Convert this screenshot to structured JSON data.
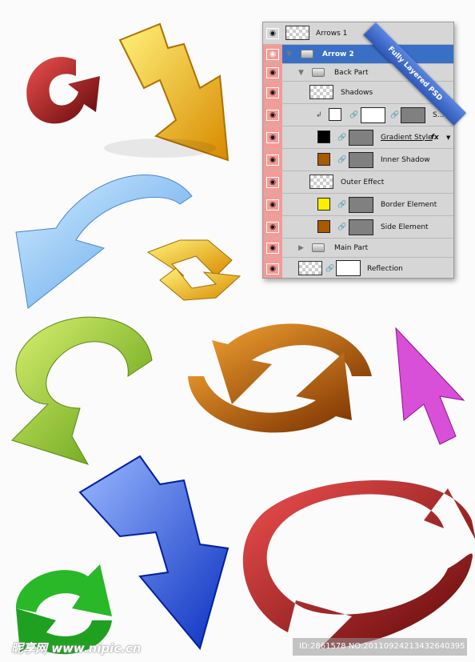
{
  "badge": "Fully Layered PSD",
  "layers": [
    {
      "name": "Arrows 1",
      "type": "smart",
      "visible": true
    },
    {
      "name": "Arrow 2",
      "type": "group",
      "expanded": true,
      "selected": true
    },
    {
      "name": "Back Part",
      "type": "group",
      "expanded": true
    },
    {
      "name": "Shadows",
      "type": "layer"
    },
    {
      "name": "S...",
      "type": "clipped",
      "swatch": "#ffffff"
    },
    {
      "name": "Gradient Style",
      "type": "shape",
      "swatch": "#000000",
      "fx": "fx"
    },
    {
      "name": "Inner Shadow",
      "type": "shape",
      "swatch": "#a85a00"
    },
    {
      "name": "Outer Effect",
      "type": "layer"
    },
    {
      "name": "Border Element",
      "type": "shape",
      "swatch": "#ffee00"
    },
    {
      "name": "Side Element",
      "type": "shape",
      "swatch": "#a85a00"
    },
    {
      "name": "Main Part",
      "type": "group",
      "expanded": false
    },
    {
      "name": "Reflection",
      "type": "masked"
    }
  ],
  "icons": {
    "visibility": "eye-icon",
    "link": "chain-link-icon",
    "folder": "folder-icon"
  },
  "arrow_colors": [
    "#b0202a",
    "#f0b800",
    "#7ab8f0",
    "#e8c000",
    "#88c020",
    "#c06000",
    "#d040d0",
    "#2050e0",
    "#20b020",
    "#b81818"
  ],
  "watermark": "昵享网 www.nipic.cn",
  "image_id": "ID:2861578 NO:20110924213432640395"
}
